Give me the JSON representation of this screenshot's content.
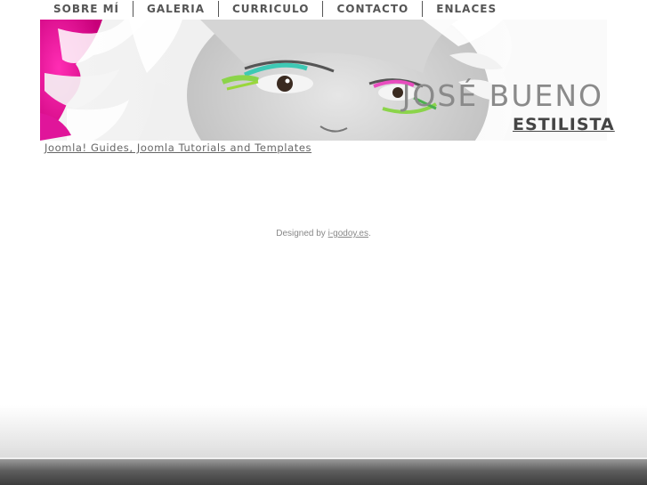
{
  "nav": {
    "items": [
      "SOBRE MÍ",
      "GALERIA",
      "CURRICULO",
      "CONTACTO",
      "ENLACES"
    ]
  },
  "header": {
    "brand": "JOSÉ BUENO",
    "tagline": "ESTILISTA"
  },
  "sublink": "Joomla! Guides, Joomla Tutorials and Templates",
  "footer": {
    "prefix": "Designed by ",
    "link": "i-godoy.es",
    "suffix": "."
  },
  "colors": {
    "accent_pink": "#e0159a",
    "text_gray": "#555555"
  }
}
